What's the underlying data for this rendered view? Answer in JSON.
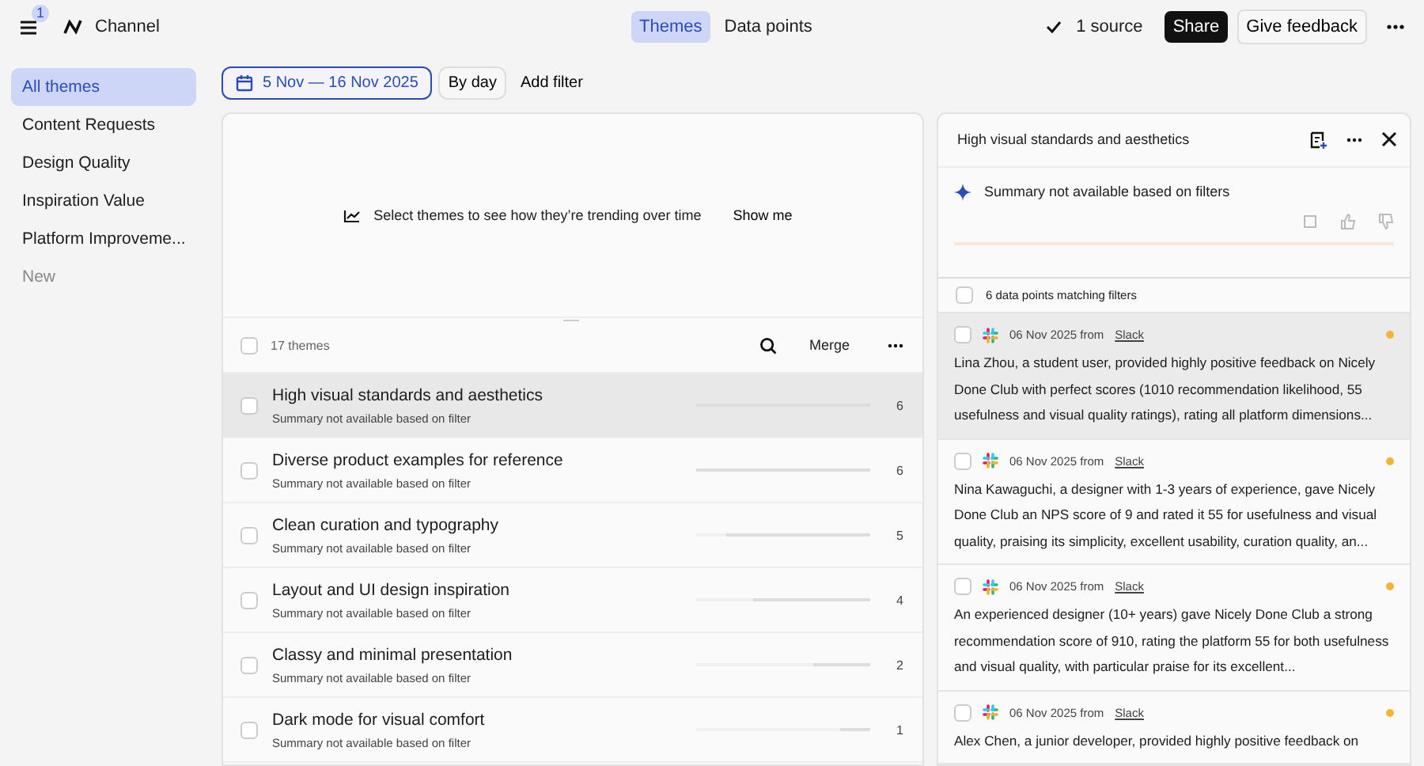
{
  "header": {
    "notification_count": "1",
    "channel": "Channel",
    "view_tabs": [
      {
        "label": "Themes",
        "selected": true
      },
      {
        "label": "Data points",
        "selected": false
      }
    ],
    "source_label": "1 source",
    "share": "Share",
    "feedback": "Give feedback"
  },
  "sidebar": {
    "items": [
      {
        "label": "All themes",
        "selected": true
      },
      {
        "label": "Content Requests",
        "selected": false
      },
      {
        "label": "Design Quality",
        "selected": false
      },
      {
        "label": "Inspiration Value",
        "selected": false
      },
      {
        "label": "Platform Improveme...",
        "selected": false
      }
    ],
    "new_label": "New"
  },
  "filters": {
    "date_range": "5 Nov — 16 Nov 2025",
    "grouping": "By day",
    "add_filter": "Add filter"
  },
  "trend": {
    "message": "Select themes to see how they’re trending over time",
    "action": "Show me"
  },
  "themes": {
    "all_checked": false,
    "count_label": "17 themes",
    "merge": "Merge",
    "rows": [
      {
        "title": "High visual standards and aesthetics",
        "summary": "Summary not available based on filter",
        "count": "6",
        "level": 1,
        "selected": true
      },
      {
        "title": "Diverse product examples for reference",
        "summary": "Summary not available based on filter",
        "count": "6",
        "level": 1,
        "selected": false
      },
      {
        "title": "Clean curation and typography",
        "summary": "Summary not available based on filter",
        "count": "5",
        "level": 0.83,
        "selected": false
      },
      {
        "title": "Layout and UI design inspiration",
        "summary": "Summary not available based on filter",
        "count": "4",
        "level": 0.67,
        "selected": false
      },
      {
        "title": "Classy and minimal presentation",
        "summary": "Summary not available based on filter",
        "count": "2",
        "level": 0.33,
        "selected": false
      },
      {
        "title": "Dark mode for visual comfort",
        "summary": "Summary not available based on filter",
        "count": "1",
        "level": 0.17,
        "selected": false
      }
    ]
  },
  "detail": {
    "title": "High visual standards and aesthetics",
    "summary": "Summary not available based on filters",
    "all_checked": false,
    "matching_label": "6 data points matching filters",
    "data_points": [
      {
        "date": "06 Nov 2025 from",
        "source": "Slack",
        "color": "#f5b530",
        "selected": true,
        "text": "Lina Zhou, a student user, provided highly positive feedback on Nicely Done Club with perfect scores (1010 recommendation likelihood, 55 usefulness and visual quality ratings), rating all platform dimensions..."
      },
      {
        "date": "06 Nov 2025 from",
        "source": "Slack",
        "color": "#f5b530",
        "selected": false,
        "text": "Nina Kawaguchi, a designer with 1-3 years of experience, gave Nicely Done Club an NPS score of 9 and rated it 55 for usefulness and visual quality, praising its simplicity, excellent usability, curation quality, an..."
      },
      {
        "date": "06 Nov 2025 from",
        "source": "Slack",
        "color": "#f5b530",
        "selected": false,
        "text": "An experienced designer (10+ years) gave Nicely Done Club a strong recommendation score of 910, rating the platform 55 for both usefulness and visual quality, with particular praise for its excellent..."
      },
      {
        "date": "06 Nov 2025 from",
        "source": "Slack",
        "color": "#f5b530",
        "selected": false,
        "text": "Alex Chen, a junior developer, provided highly positive feedback on"
      }
    ]
  }
}
